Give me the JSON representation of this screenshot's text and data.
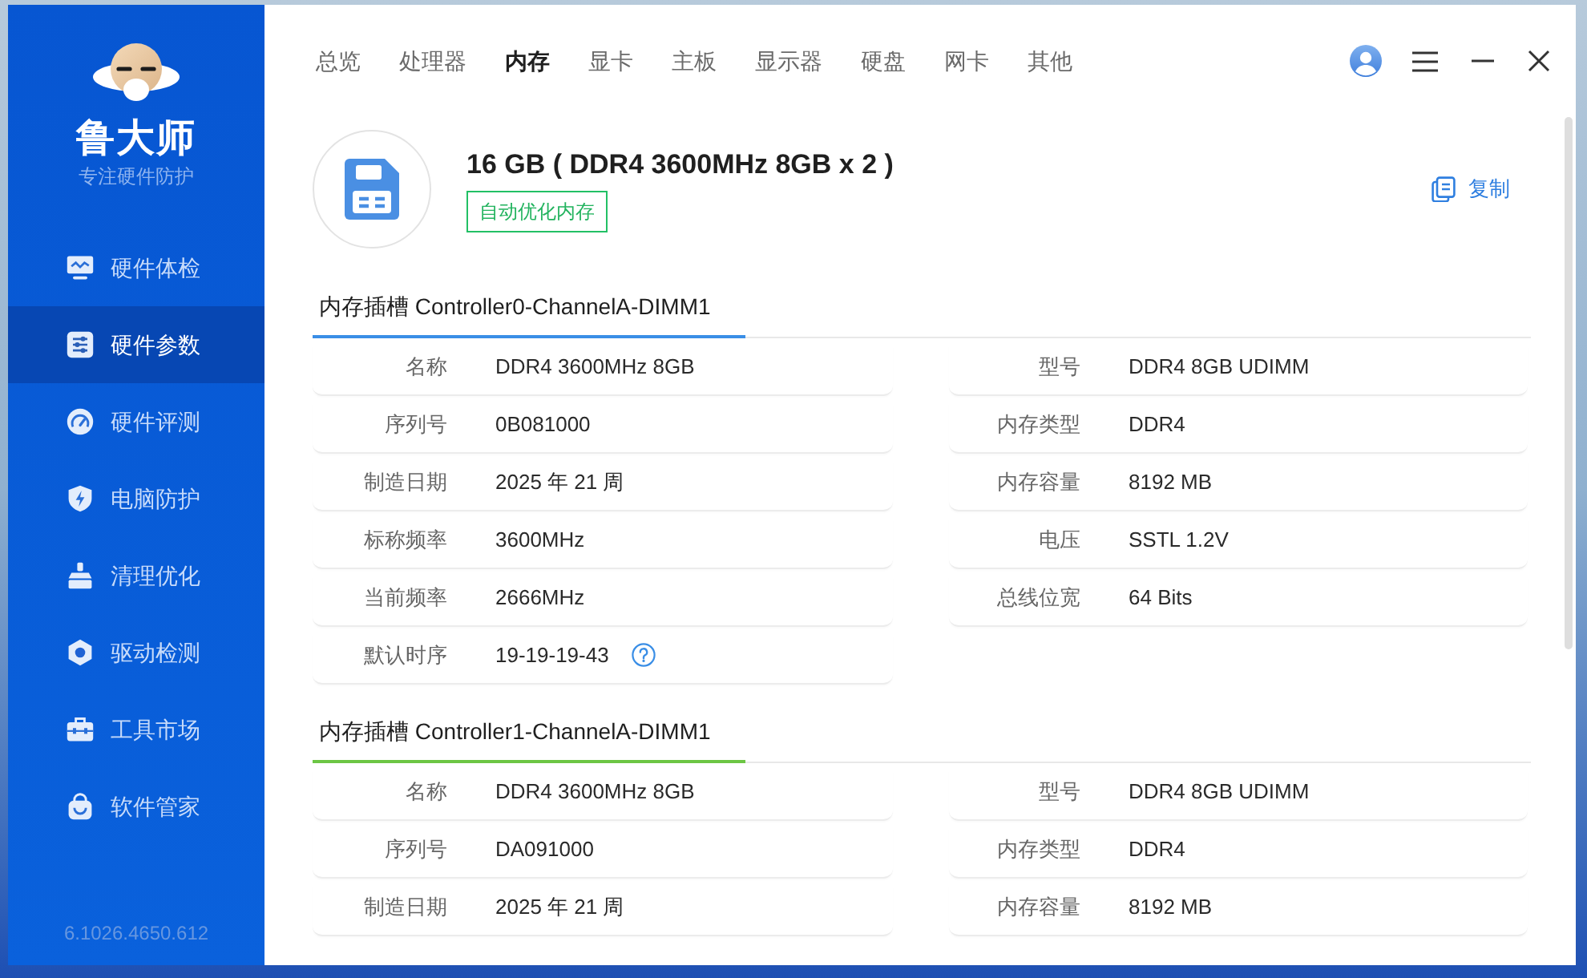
{
  "sidebar": {
    "app_name": "鲁大师",
    "tagline": "专注硬件防护",
    "items": [
      {
        "label": "硬件体检",
        "selected": false
      },
      {
        "label": "硬件参数",
        "selected": true
      },
      {
        "label": "硬件评测",
        "selected": false
      },
      {
        "label": "电脑防护",
        "selected": false
      },
      {
        "label": "清理优化",
        "selected": false
      },
      {
        "label": "驱动检测",
        "selected": false
      },
      {
        "label": "工具市场",
        "selected": false
      },
      {
        "label": "软件管家",
        "selected": false
      }
    ],
    "version": "6.1026.4650.612"
  },
  "tabs": [
    {
      "label": "总览",
      "selected": false
    },
    {
      "label": "处理器",
      "selected": false
    },
    {
      "label": "内存",
      "selected": true
    },
    {
      "label": "显卡",
      "selected": false
    },
    {
      "label": "主板",
      "selected": false
    },
    {
      "label": "显示器",
      "selected": false
    },
    {
      "label": "硬盘",
      "selected": false
    },
    {
      "label": "网卡",
      "selected": false
    },
    {
      "label": "其他",
      "selected": false
    }
  ],
  "summary": {
    "title": "16 GB ( DDR4 3600MHz 8GB x 2 )",
    "optimize_button": "自动优化内存",
    "copy_button": "复制"
  },
  "slots": [
    {
      "title": "内存插槽 Controller0-ChannelA-DIMM1",
      "color": "#3a8ee6",
      "left": [
        {
          "label": "名称",
          "value": "DDR4 3600MHz 8GB",
          "help": false
        },
        {
          "label": "序列号",
          "value": "0B081000",
          "help": false
        },
        {
          "label": "制造日期",
          "value": "2025 年 21 周",
          "help": false
        },
        {
          "label": "标称频率",
          "value": "3600MHz",
          "help": false
        },
        {
          "label": "当前频率",
          "value": "2666MHz",
          "help": false
        },
        {
          "label": "默认时序",
          "value": "19-19-19-43",
          "help": true
        }
      ],
      "right": [
        {
          "label": "型号",
          "value": "DDR4 8GB UDIMM",
          "help": false
        },
        {
          "label": "内存类型",
          "value": "DDR4",
          "help": false
        },
        {
          "label": "内存容量",
          "value": "8192 MB",
          "help": false
        },
        {
          "label": "电压",
          "value": "SSTL 1.2V",
          "help": false
        },
        {
          "label": "总线位宽",
          "value": "64 Bits",
          "help": false
        }
      ]
    },
    {
      "title": "内存插槽 Controller1-ChannelA-DIMM1",
      "color": "#6cc644",
      "left": [
        {
          "label": "名称",
          "value": "DDR4 3600MHz 8GB",
          "help": false
        },
        {
          "label": "序列号",
          "value": "DA091000",
          "help": false
        },
        {
          "label": "制造日期",
          "value": "2025 年 21 周",
          "help": false
        }
      ],
      "right": [
        {
          "label": "型号",
          "value": "DDR4 8GB UDIMM",
          "help": false
        },
        {
          "label": "内存类型",
          "value": "DDR4",
          "help": false
        },
        {
          "label": "内存容量",
          "value": "8192 MB",
          "help": false
        }
      ]
    }
  ]
}
